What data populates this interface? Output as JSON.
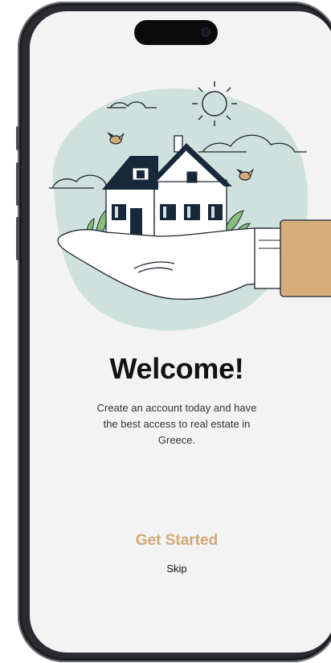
{
  "onboarding": {
    "title": "Welcome!",
    "subtitle": "Create an account today and have the best access to real estate in Greece.",
    "get_started_label": "Get Started",
    "skip_label": "Skip"
  },
  "illustration": {
    "subject": "house-in-hand",
    "blob_color": "#cfe1dc",
    "roof_color": "#17283a",
    "sleeve_color": "#d6ad7a"
  },
  "theme": {
    "accent": "#d1a977",
    "background": "#f3f3f3",
    "text": "#111111"
  }
}
